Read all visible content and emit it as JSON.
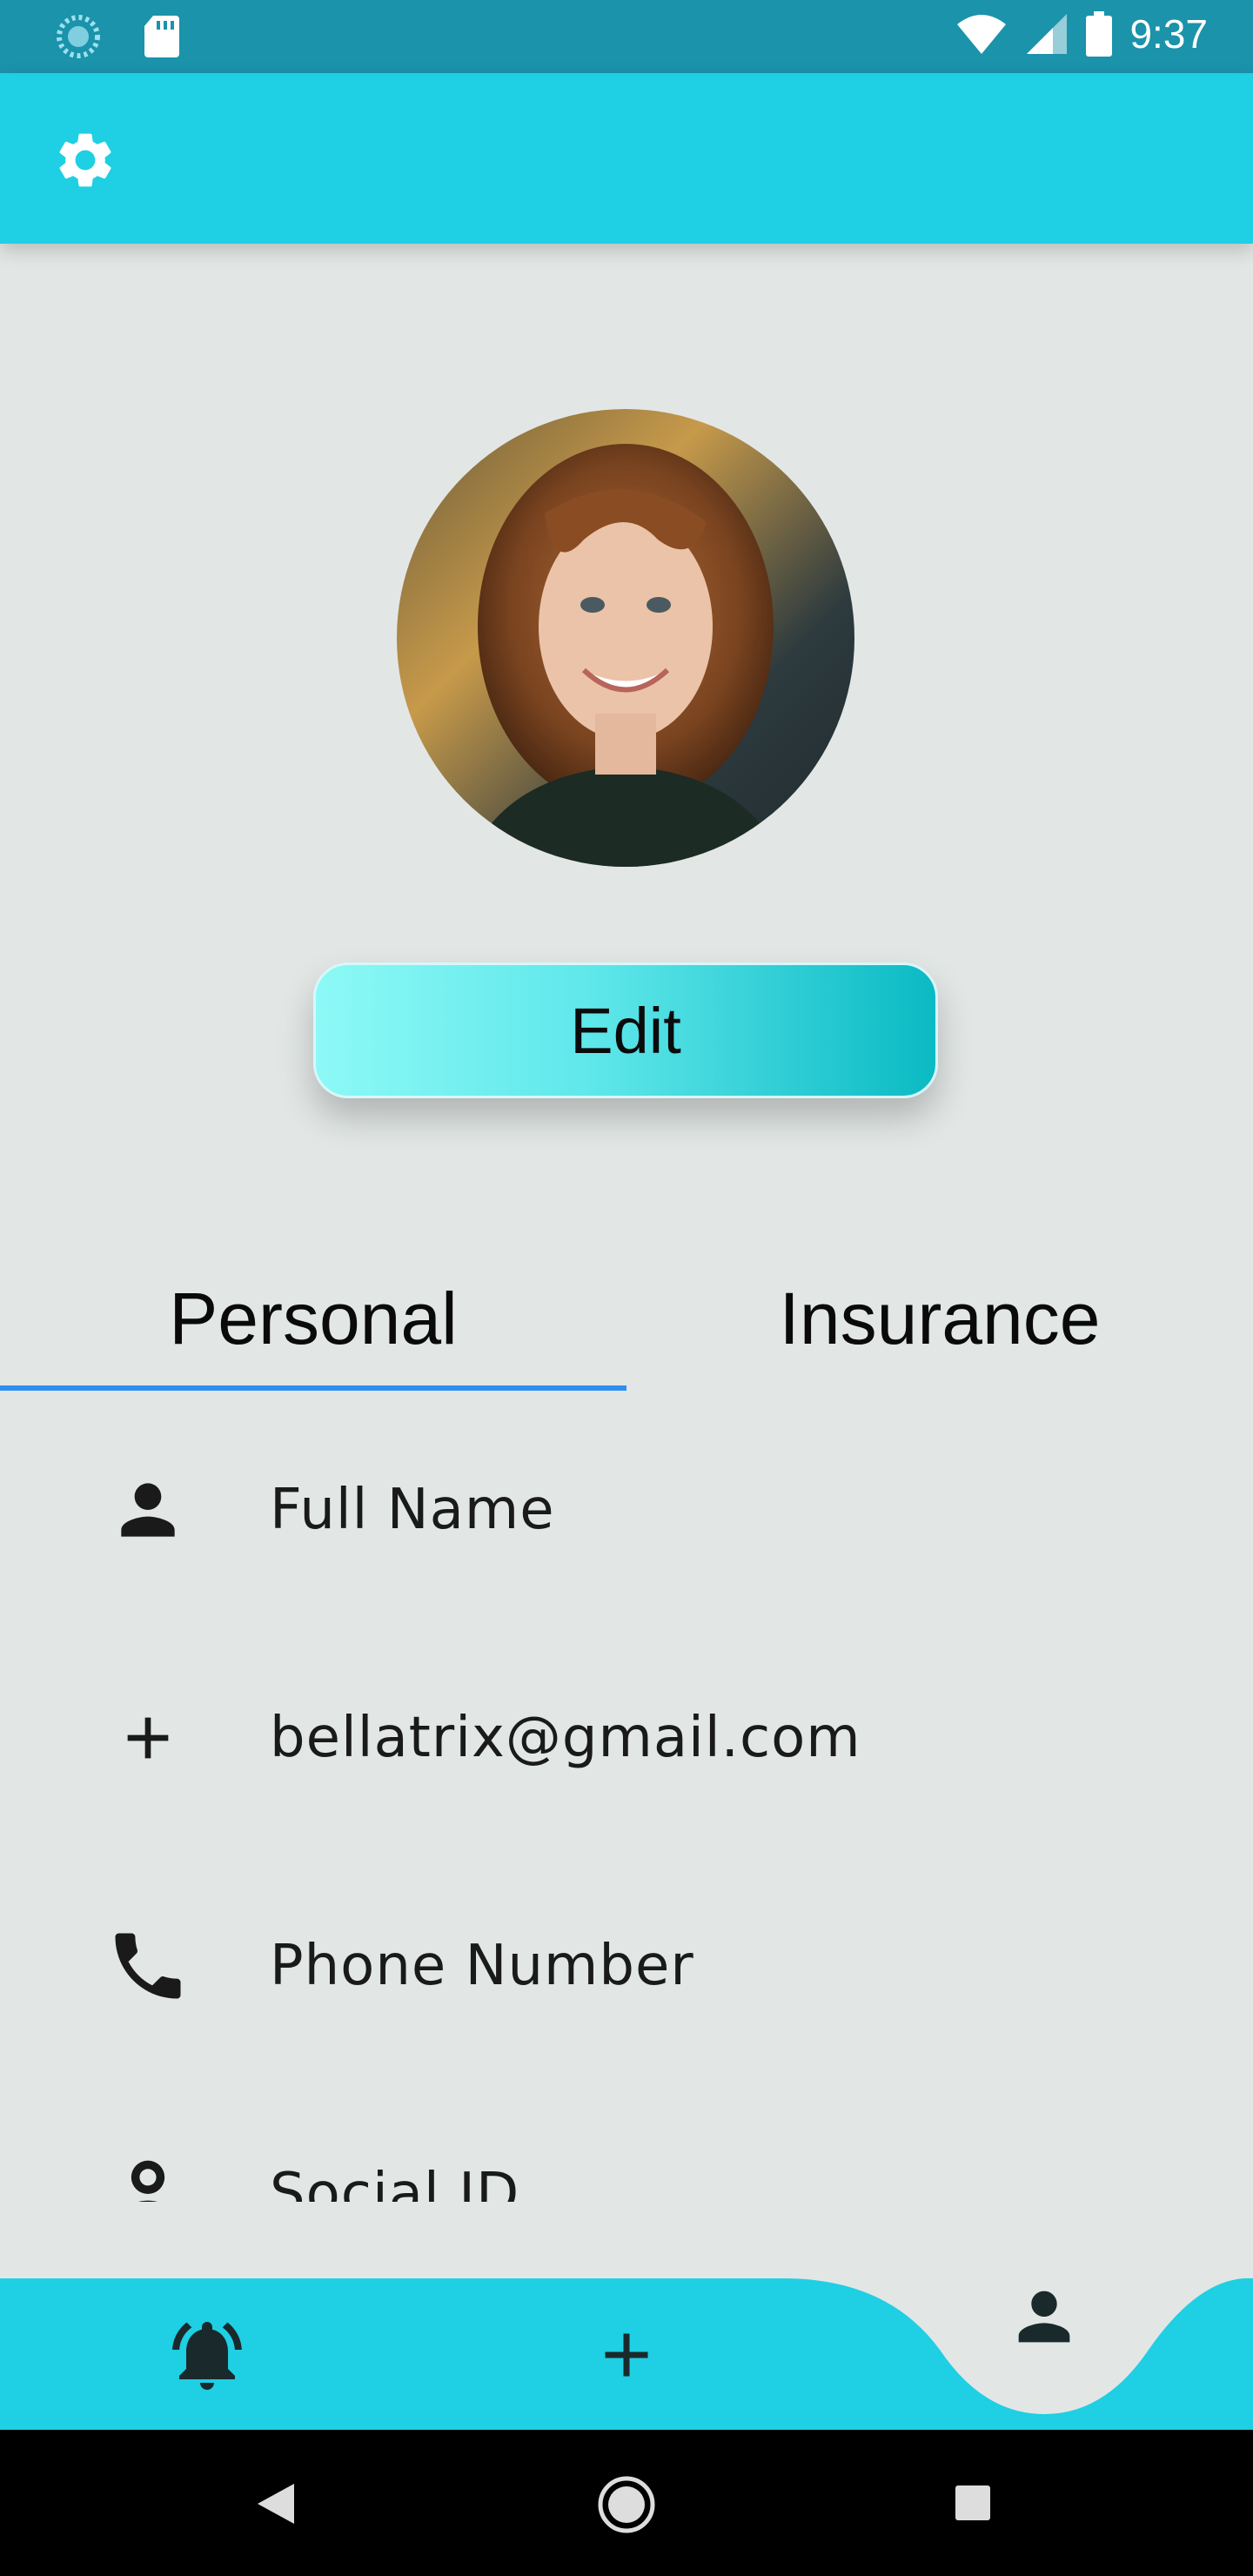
{
  "status_bar": {
    "time": "9:37",
    "icons": [
      "loading-icon",
      "sd-card-icon",
      "wifi-icon",
      "signal-icon",
      "battery-icon"
    ]
  },
  "app_bar": {
    "settings_icon": "gear-icon",
    "color": "#1fcfe3"
  },
  "profile": {
    "avatar": "profile-photo",
    "edit_label": "Edit"
  },
  "tabs": [
    {
      "label": "Personal",
      "selected": true
    },
    {
      "label": "Insurance",
      "selected": false
    }
  ],
  "fields": [
    {
      "icon": "person-icon",
      "label": "Full Name"
    },
    {
      "icon": "plus-icon",
      "label": "bellatrix@gmail.com"
    },
    {
      "icon": "phone-icon",
      "label": "Phone Number"
    },
    {
      "icon": "id-icon",
      "label": "Social ID"
    }
  ],
  "bottom_nav": [
    {
      "icon": "bell-icon",
      "selected": false
    },
    {
      "icon": "plus-icon",
      "selected": false
    },
    {
      "icon": "person-icon",
      "selected": true
    }
  ],
  "system_nav": [
    "back-icon",
    "home-icon",
    "recents-icon"
  ],
  "colors": {
    "accent": "#1fcfe3",
    "status_bar": "#1a93ab",
    "tab_indicator": "#2f8ff0",
    "background": "#e2e7e6"
  }
}
